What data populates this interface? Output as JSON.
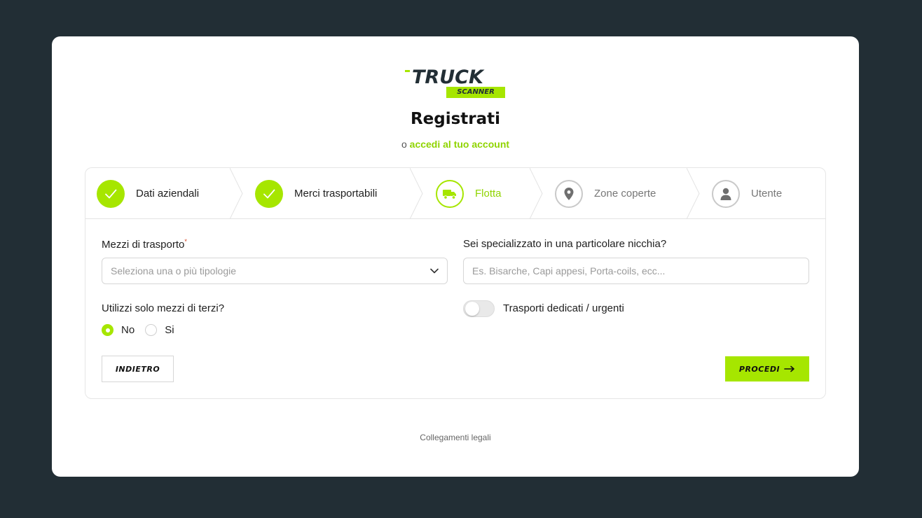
{
  "brand": {
    "word_top": "TRUCK",
    "word_bottom": "SCANNER",
    "accent": "#a6e600",
    "dark": "#222e35"
  },
  "page": {
    "title": "Registrati",
    "sub_prefix": "o",
    "login_link": "accedi al tuo account"
  },
  "steps": [
    {
      "label": "Dati aziendali",
      "state": "done",
      "icon": "check-icon"
    },
    {
      "label": "Merci trasportabili",
      "state": "done",
      "icon": "check-icon"
    },
    {
      "label": "Flotta",
      "state": "active",
      "icon": "truck-icon"
    },
    {
      "label": "Zone coperte",
      "state": "todo",
      "icon": "location-pin-icon"
    },
    {
      "label": "Utente",
      "state": "todo",
      "icon": "user-icon"
    }
  ],
  "form": {
    "vehicles_label": "Mezzi di trasporto",
    "vehicles_required_mark": "*",
    "vehicles_placeholder": "Seleziona una o più tipologie",
    "niche_label": "Sei specializzato in una particolare nicchia?",
    "niche_placeholder": "Es. Bisarche, Capi appesi, Porta-coils, ecc...",
    "third_party_label": "Utilizzi solo mezzi di terzi?",
    "option_no": "No",
    "option_yes": "Si",
    "selected_option": "No",
    "dedicated_label": "Trasporti dedicati / urgenti",
    "dedicated_on": false
  },
  "buttons": {
    "back": "INDIETRO",
    "next": "PROCEDI"
  },
  "footer": {
    "legal": "Collegamenti legali"
  }
}
